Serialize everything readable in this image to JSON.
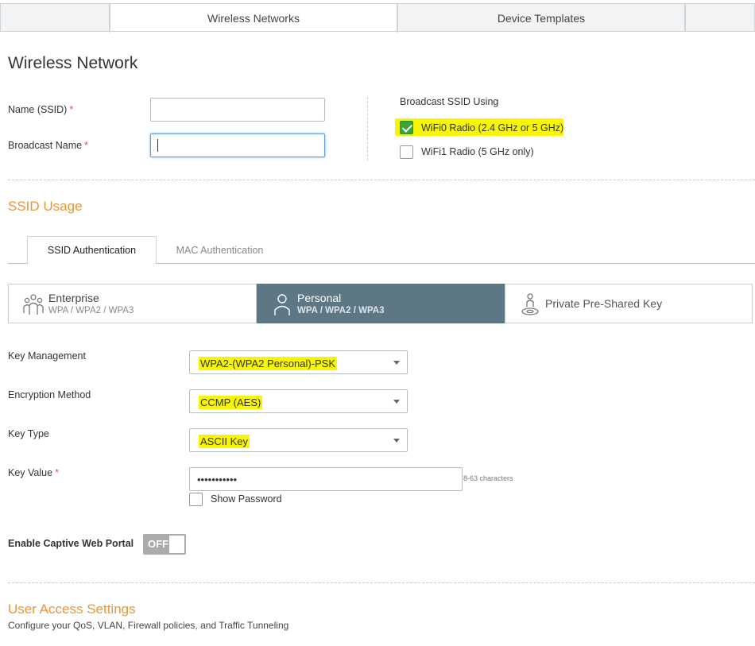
{
  "tabs": [
    {
      "label": ""
    },
    {
      "label": "Wireless Networks"
    },
    {
      "label": "Device Templates"
    },
    {
      "label": ""
    }
  ],
  "page_title": "Wireless Network",
  "form": {
    "name_label": "Name (SSID)",
    "name_value": "",
    "broadcast_label": "Broadcast Name",
    "broadcast_value": "",
    "required_mark": "*"
  },
  "broadcast": {
    "title": "Broadcast SSID Using",
    "options": [
      {
        "label": "WiFi0 Radio (2.4 GHz or 5 GHz)",
        "checked": true
      },
      {
        "label": "WiFi1 Radio (5 GHz only)",
        "checked": false
      }
    ]
  },
  "ssid_usage": {
    "title": "SSID Usage",
    "subtabs": [
      {
        "label": "SSID Authentication",
        "active": true
      },
      {
        "label": "MAC Authentication",
        "active": false
      }
    ],
    "auth_types": [
      {
        "title": "Enterprise",
        "sub": "WPA / WPA2 / WPA3",
        "icon": "users-icon",
        "active": false
      },
      {
        "title": "Personal",
        "sub": "WPA / WPA2 / WPA3",
        "icon": "user-icon",
        "active": true
      },
      {
        "title": "Private Pre-Shared Key",
        "sub": "",
        "icon": "private-user-icon",
        "active": false
      }
    ]
  },
  "security": {
    "key_management_label": "Key Management",
    "key_management_value": "WPA2-(WPA2 Personal)-PSK",
    "encryption_label": "Encryption Method",
    "encryption_value": "CCMP (AES)",
    "key_type_label": "Key Type",
    "key_type_value": "ASCII Key",
    "key_value_label": "Key Value",
    "key_value_masked": "•••••••••••",
    "key_hint": "8-63 characters",
    "show_password_label": "Show Password",
    "show_password_checked": false
  },
  "captive_portal": {
    "label": "Enable Captive Web Portal",
    "state": "OFF"
  },
  "user_access": {
    "title": "User Access Settings",
    "description": "Configure your QoS, VLAN, Firewall policies, and Traffic Tunneling"
  },
  "colors": {
    "accent_orange": "#e8963a",
    "active_auth": "#5e7785",
    "highlight": "#f7f500",
    "checkbox_green": "#3aa535"
  }
}
